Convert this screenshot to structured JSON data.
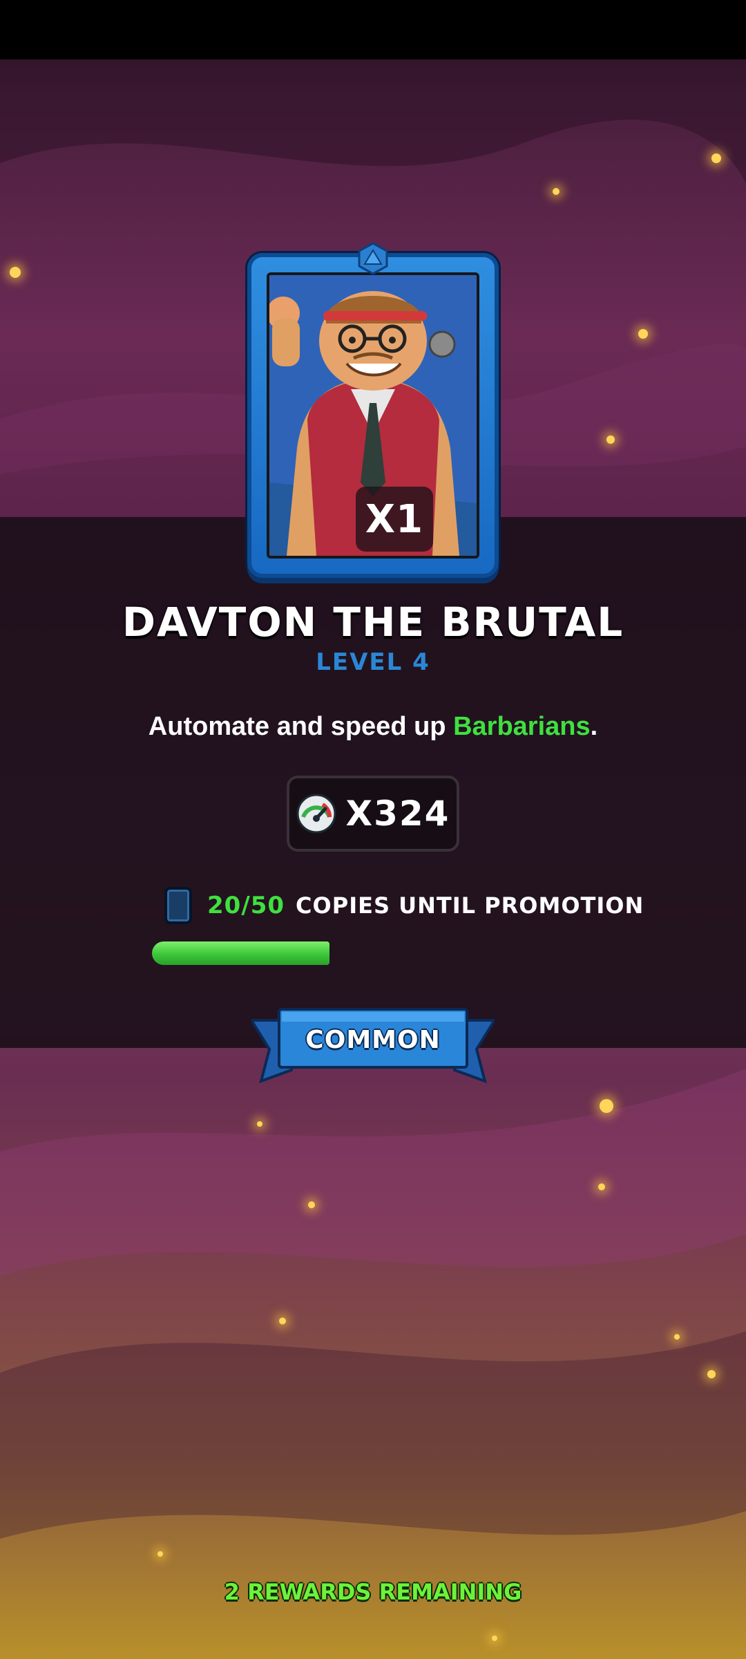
{
  "card": {
    "count_label": "X1",
    "portrait_icon": "barbarian-hero-portrait"
  },
  "hero": {
    "name": "DAVTON THE BRUTAL",
    "level": "LEVEL 4"
  },
  "description": {
    "prefix": "Automate and speed up ",
    "highlight": "Barbarians",
    "suffix": "."
  },
  "stat": {
    "icon": "speed-gauge-icon",
    "value": "X324"
  },
  "promotion": {
    "count": "20/50",
    "label": "COPIES UNTIL PROMOTION",
    "progress_fraction": 0.4
  },
  "rarity": {
    "label": "COMMON"
  },
  "footer": {
    "rewards_remaining": "2 REWARDS REMAINING"
  },
  "colors": {
    "accent_green": "#3fe03f",
    "level_blue": "#2a87d6",
    "ribbon_blue": "#2a86d8"
  }
}
